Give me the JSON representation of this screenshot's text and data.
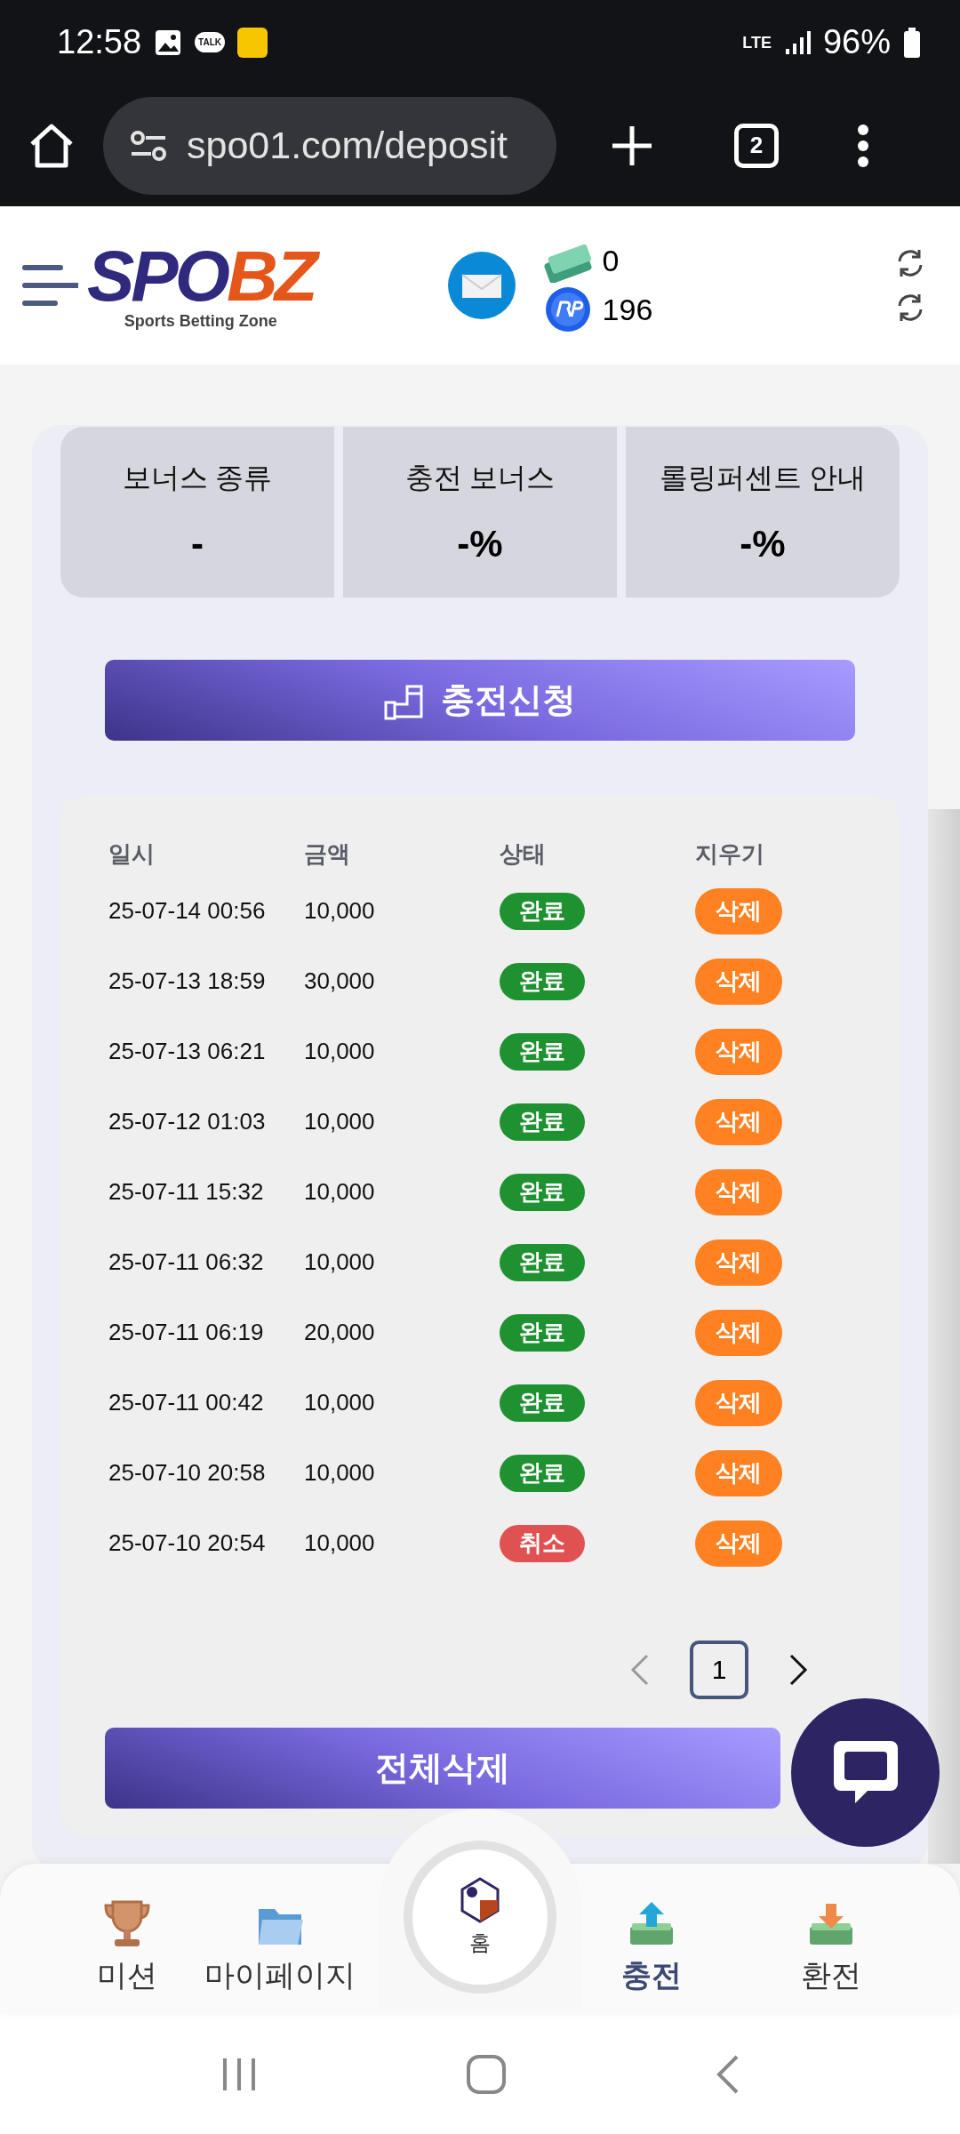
{
  "status_bar": {
    "time": "12:58",
    "talk_label": "TALK",
    "network": "LTE",
    "battery": "96%"
  },
  "browser": {
    "url": "spo01.com/deposit",
    "tab_count": "2"
  },
  "header": {
    "logo_left": "SPO",
    "logo_right": "BZ",
    "tagline": "Sports Betting Zone",
    "cash": "0",
    "points": "196"
  },
  "bonus": [
    {
      "label": "보너스 종류",
      "value": "-"
    },
    {
      "label": "충전 보너스",
      "value": "-%"
    },
    {
      "label": "롤링퍼센트 안내",
      "value": "-%"
    }
  ],
  "apply_button": "충전신청",
  "table": {
    "columns": [
      "일시",
      "금액",
      "상태",
      "지우기"
    ],
    "rows": [
      {
        "date": "25-07-14 00:56",
        "amount": "10,000",
        "status": "완료",
        "kind": "done",
        "action": "삭제"
      },
      {
        "date": "25-07-13 18:59",
        "amount": "30,000",
        "status": "완료",
        "kind": "done",
        "action": "삭제"
      },
      {
        "date": "25-07-13 06:21",
        "amount": "10,000",
        "status": "완료",
        "kind": "done",
        "action": "삭제"
      },
      {
        "date": "25-07-12 01:03",
        "amount": "10,000",
        "status": "완료",
        "kind": "done",
        "action": "삭제"
      },
      {
        "date": "25-07-11 15:32",
        "amount": "10,000",
        "status": "완료",
        "kind": "done",
        "action": "삭제"
      },
      {
        "date": "25-07-11 06:32",
        "amount": "10,000",
        "status": "완료",
        "kind": "done",
        "action": "삭제"
      },
      {
        "date": "25-07-11 06:19",
        "amount": "20,000",
        "status": "완료",
        "kind": "done",
        "action": "삭제"
      },
      {
        "date": "25-07-11 00:42",
        "amount": "10,000",
        "status": "완료",
        "kind": "done",
        "action": "삭제"
      },
      {
        "date": "25-07-10 20:58",
        "amount": "10,000",
        "status": "완료",
        "kind": "done",
        "action": "삭제"
      },
      {
        "date": "25-07-10 20:54",
        "amount": "10,000",
        "status": "취소",
        "kind": "cancelled",
        "action": "삭제"
      }
    ]
  },
  "pagination": {
    "prev_disabled": true,
    "pages": [
      {
        "label": "1",
        "selected": true
      }
    ]
  },
  "delete_all_button": "전체삭제",
  "bottom_nav": [
    {
      "label": "미션",
      "kind": "trophy",
      "selected": false
    },
    {
      "label": "마이페이지",
      "kind": "folder",
      "selected": false
    },
    {
      "label": "홈",
      "kind": "home",
      "selected": false
    },
    {
      "label": "충전",
      "kind": "deposit",
      "selected": true
    },
    {
      "label": "환전",
      "kind": "withdraw",
      "selected": false
    }
  ]
}
